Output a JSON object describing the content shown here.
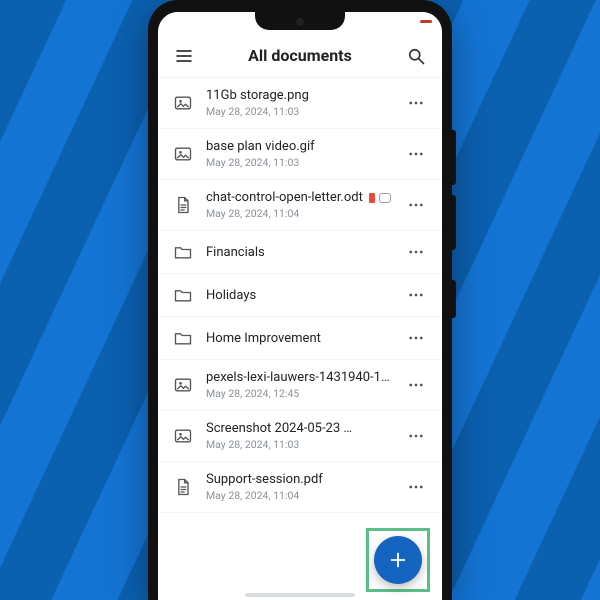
{
  "header": {
    "title": "All documents"
  },
  "files": [
    {
      "icon": "image",
      "name": "11Gb storage.png",
      "date": "May 28, 2024, 11:03",
      "badges": []
    },
    {
      "icon": "image",
      "name": "base plan video.gif",
      "date": "May 28, 2024, 11:03",
      "badges": []
    },
    {
      "icon": "doc",
      "name": "chat-control-open-letter.odt",
      "date": "May 28, 2024, 11:04",
      "badges": [
        "red",
        "comment"
      ]
    },
    {
      "icon": "folder",
      "name": "Financials",
      "date": "",
      "badges": []
    },
    {
      "icon": "folder",
      "name": "Holidays",
      "date": "",
      "badges": []
    },
    {
      "icon": "folder",
      "name": "Home Improvement",
      "date": "",
      "badges": []
    },
    {
      "icon": "image",
      "name": "pexels-lexi-lauwers-1431940-1…",
      "date": "May 28, 2024, 12:45",
      "badges": []
    },
    {
      "icon": "image",
      "name": "Screenshot 2024-05-23 …",
      "date": "May 28, 2024, 11:03",
      "badges": []
    },
    {
      "icon": "doc",
      "name": "Support-session.pdf",
      "date": "May 28, 2024, 11:04",
      "badges": []
    }
  ]
}
